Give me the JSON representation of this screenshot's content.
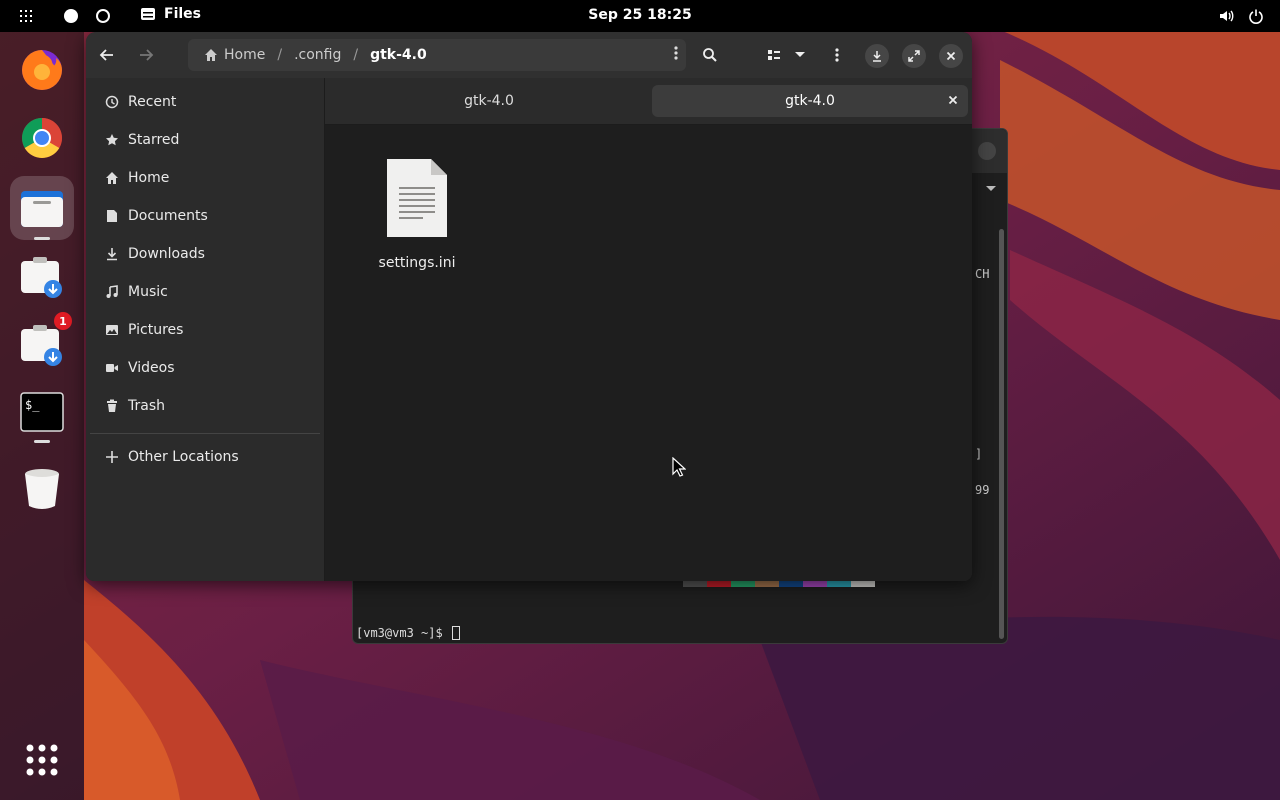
{
  "topbar": {
    "app_name": "Files",
    "clock": "Sep 25  18:25"
  },
  "dock": {
    "apps": [
      {
        "name": "Firefox",
        "icon": "firefox-icon"
      },
      {
        "name": "Chrome",
        "icon": "chrome-icon"
      },
      {
        "name": "Files",
        "icon": "files-icon",
        "active": true
      },
      {
        "name": "Installer",
        "icon": "installer-icon"
      },
      {
        "name": "Installer updates",
        "icon": "installer-icon",
        "badge": "1"
      },
      {
        "name": "Terminal",
        "icon": "terminal-icon"
      },
      {
        "name": "Trash",
        "icon": "trash-icon"
      }
    ]
  },
  "files": {
    "path": {
      "home": "Home",
      "sep": "/",
      "config": ".config",
      "current": "gtk-4.0"
    },
    "sidebar": {
      "items": [
        {
          "label": "Recent",
          "icon": "clock-icon"
        },
        {
          "label": "Starred",
          "icon": "star-icon"
        },
        {
          "label": "Home",
          "icon": "home-icon"
        },
        {
          "label": "Documents",
          "icon": "document-icon"
        },
        {
          "label": "Downloads",
          "icon": "download-icon"
        },
        {
          "label": "Music",
          "icon": "music-icon"
        },
        {
          "label": "Pictures",
          "icon": "picture-icon"
        },
        {
          "label": "Videos",
          "icon": "video-icon"
        },
        {
          "label": "Trash",
          "icon": "trash-icon"
        }
      ],
      "other_locations": "Other Locations"
    },
    "tabs": [
      {
        "label": "gtk-4.0"
      },
      {
        "label": "gtk-4.0",
        "active": true,
        "close": "×"
      }
    ],
    "content": {
      "file_name": "settings.ini"
    }
  },
  "terminal": {
    "prompt": "[vm3@vm3 ~]$ ",
    "fragments": [
      "CH",
      "]",
      "99"
    ]
  },
  "colors": {
    "accent": "#3584e4",
    "badge": "#e01b24",
    "palette": [
      "#555555",
      "#c01c28",
      "#26a269",
      "#a2734c",
      "#12488b",
      "#a347ba",
      "#2aa1b3",
      "#d0cfcc"
    ]
  }
}
